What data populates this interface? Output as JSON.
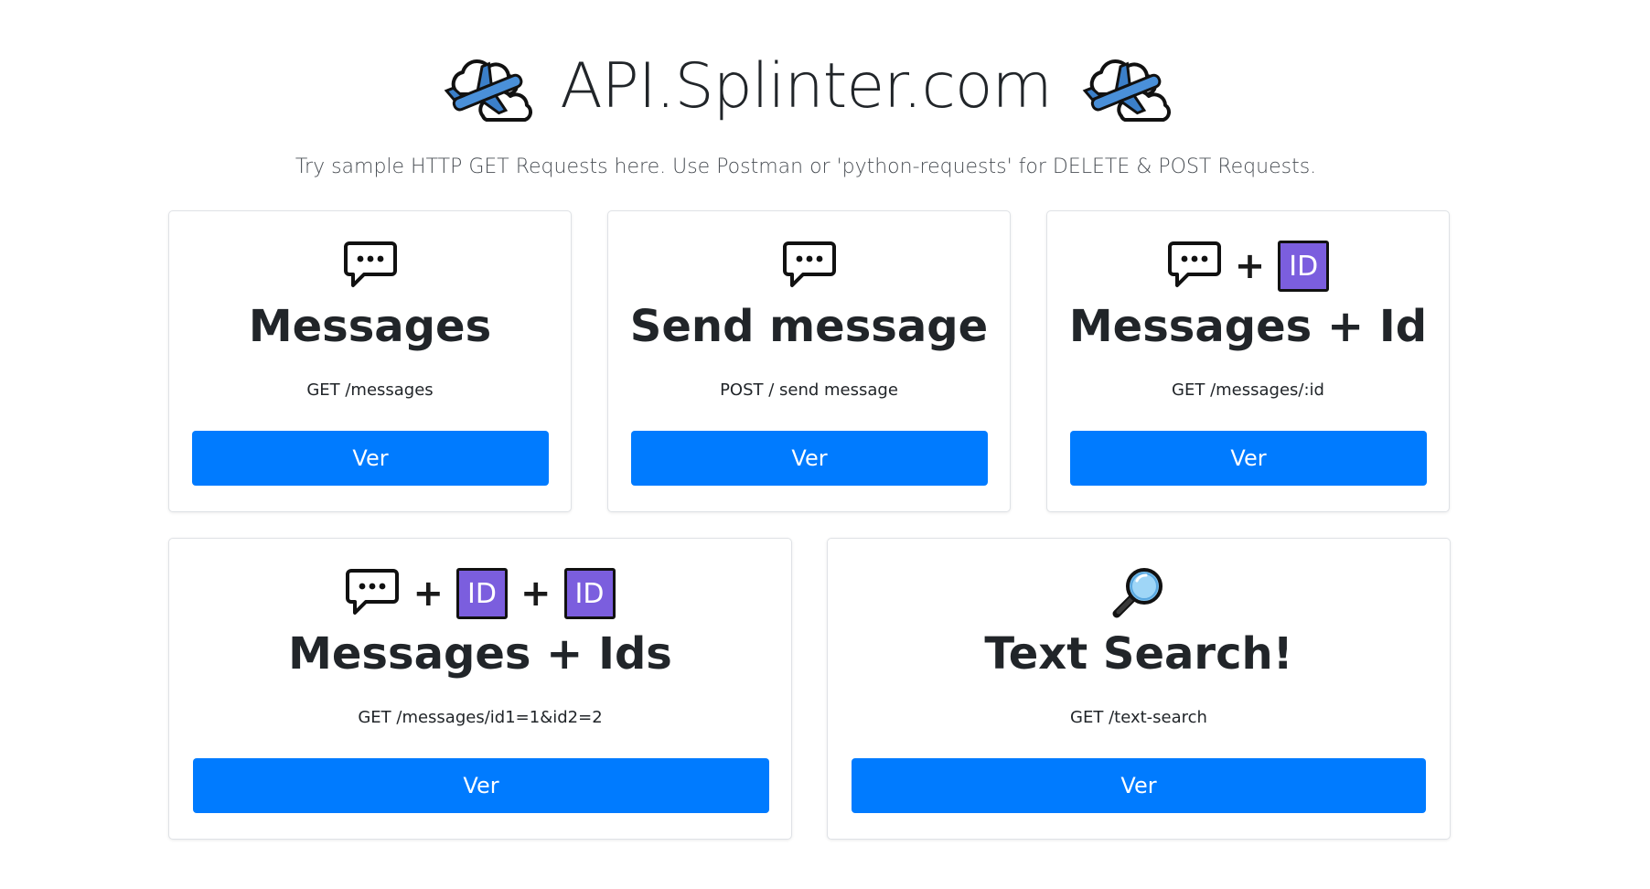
{
  "header": {
    "title": "API.Splinter.com",
    "subtitle": "Try sample HTTP GET Requests here. Use Postman or 'python-requests' for DELETE & POST Requests.",
    "left_icon": "cloud-airplane-icon",
    "right_icon": "cloud-airplane-icon"
  },
  "cards": [
    {
      "title": "Messages",
      "endpoint": "GET /messages",
      "button": "Ver",
      "icons": [
        "speech-bubble-icon"
      ]
    },
    {
      "title": "Send message",
      "endpoint": "POST / send message",
      "button": "Ver",
      "icons": [
        "speech-bubble-icon"
      ]
    },
    {
      "title": "Messages + Id",
      "endpoint": "GET /messages/:id",
      "button": "Ver",
      "icons": [
        "speech-bubble-icon",
        "plus",
        "id-icon"
      ]
    },
    {
      "title": "Messages + Ids",
      "endpoint": "GET /messages/id1=1&id2=2",
      "button": "Ver",
      "icons": [
        "speech-bubble-icon",
        "plus",
        "id-icon",
        "plus",
        "id-icon"
      ]
    },
    {
      "title": "Text Search!",
      "endpoint": "GET /text-search",
      "button": "Ver",
      "icons": [
        "magnifying-glass-icon"
      ]
    }
  ],
  "icon_text": {
    "plus": "+",
    "id": "ID"
  },
  "colors": {
    "button": "#007bff",
    "id_badge": "#7b5ede"
  }
}
